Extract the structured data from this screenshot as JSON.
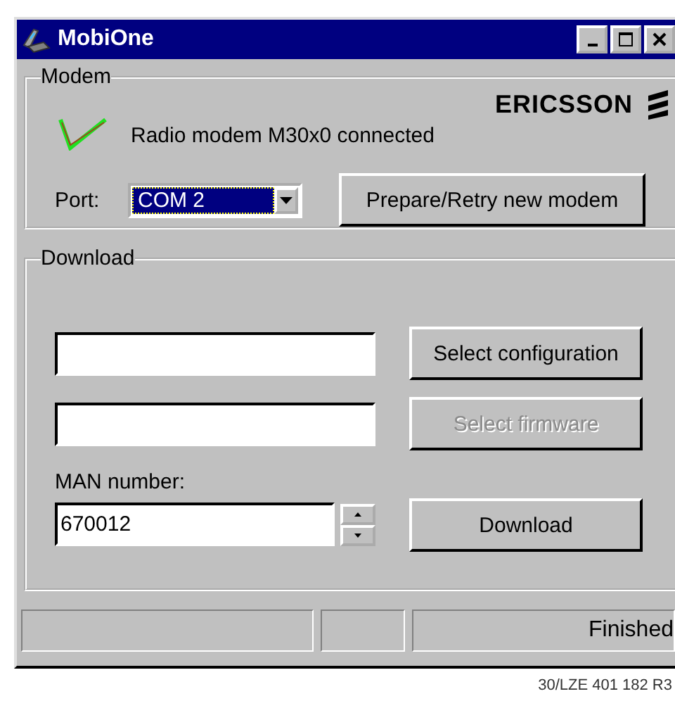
{
  "window": {
    "title": "MobiOne"
  },
  "modem": {
    "legend": "Modem",
    "brand": "ERICSSON",
    "connected": true,
    "status": "Radio modem M30x0 connected",
    "port_label": "Port:",
    "port": "COM 2",
    "prepare_button": "Prepare/Retry new modem"
  },
  "download": {
    "legend": "Download",
    "buttons": [
      {
        "label": "Select configuration",
        "disabled": false
      },
      {
        "label": "Select firmware",
        "disabled": true
      }
    ],
    "man_label": "MAN number:",
    "man_value": "670012",
    "download_button": {
      "label": "Download",
      "disabled": false
    }
  },
  "status_bar": {
    "message": "Finished"
  },
  "footer": "30/LZE 401 182 R3"
}
